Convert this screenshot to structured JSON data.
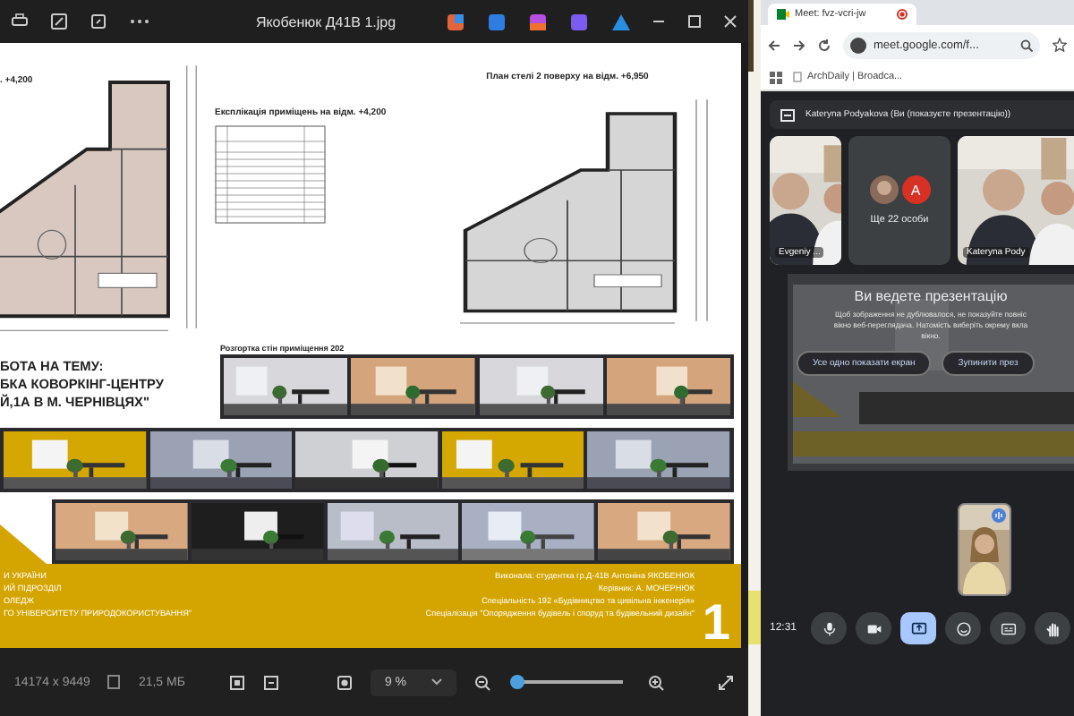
{
  "viewer": {
    "title": "Якобенюк Д41В 1.jpg",
    "poster": {
      "left_plan_label": ". +4,200",
      "explication_title": "Експлікація приміщень на відм. +4,200",
      "right_plan_title": "План стелі 2 поверху на відм. +6,950",
      "elevation_caption": "Розгортка стін приміщення 202",
      "topic_lines": [
        "БОТА НА ТЕМУ:",
        "БКА КОВОРКІНГ-ЦЕНТРУ",
        "Й,1А В М. ЧЕРНІВЦЯХ\""
      ],
      "band_left": [
        "И УКРАЇНИ",
        "ИЙ ПІДРОЗДІЛ",
        "ОЛЕДЖ",
        "ГО УНІВЕРСИТЕТУ ПРИРОДОКОРИСТУВАННЯ\""
      ],
      "band_right": [
        "Виконала: студентка гр.Д-41В  Антоніна ЯКОБЕНЮК",
        "Керівник: А. МОЧЕРНЮК",
        "Спеціальність 192 «Будівництво та цивільна інженерія»",
        "Спеціалізація \"Опорядження будівель і споруд та будівельний дизайн\""
      ],
      "sheet_number": "1"
    },
    "dimensions": "14174 x 9449",
    "file_size": "21,5 МБ",
    "zoom": "9 %",
    "zoom_slider": {
      "level": 0.02
    }
  },
  "browser": {
    "tab_title": "Meet: fvz-vcri-jw",
    "address": "meet.google.com/f...",
    "bookmark": "ArchDaily | Broadca..."
  },
  "meet": {
    "presenter_banner": "Kateryna Podyakova (Ви (показуєте презентацію))",
    "tiles": [
      {
        "kind": "video",
        "name": "Evgeniy ..."
      },
      {
        "kind": "others",
        "avatar_letter": "A",
        "label": "Ще 22 особи"
      },
      {
        "kind": "video",
        "name": "Kateryna Pody"
      }
    ],
    "overlay": {
      "title": "Ви ведете презентацію",
      "message_lines": [
        "Щоб зображення не дублювалося, не показуйте повніс",
        "вікно веб-переглядача. Натомість виберіть окрему вкла",
        "вікно."
      ],
      "buttons": [
        "Усе одно показати екран",
        "Зупинити през"
      ]
    },
    "time": "12:31",
    "controls": [
      {
        "kind": "mic",
        "selected": false
      },
      {
        "kind": "camera",
        "selected": false
      },
      {
        "kind": "present",
        "selected": true
      },
      {
        "kind": "emoji",
        "selected": false
      },
      {
        "kind": "captions",
        "selected": false
      },
      {
        "kind": "hand",
        "selected": false
      }
    ]
  }
}
